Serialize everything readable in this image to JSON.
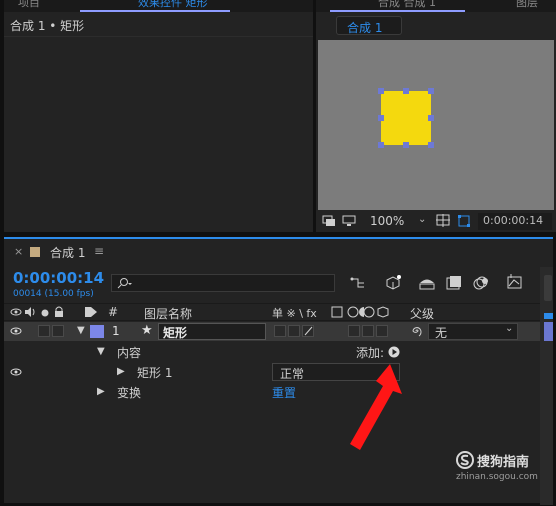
{
  "effect_controls": {
    "top_tab_left": "项目",
    "top_tab_right": "效果控件 矩形",
    "comp_breadcrumb": "合成 1 • 矩形"
  },
  "composition_viewer": {
    "tab_label": "合成 1",
    "top_tab": "合成 合成 1",
    "top_tab_right": "图层",
    "zoom_value": "100%",
    "timecode": "0:00:00:14",
    "shape_color": "#f4d90e"
  },
  "timeline": {
    "tab_title": "合成 1",
    "current_time": "0:00:00:14",
    "frame_info": "00014 (15.00 fps)",
    "search_placeholder": "",
    "col_hash": "#",
    "col_layer_name": "图层名称",
    "col_parent": "父级",
    "switch_icons": "单 ※ \\ fx",
    "layer": {
      "index": "1",
      "name": "矩形",
      "parent_value": "无"
    },
    "contents_label": "内容",
    "add_label": "添加:",
    "rect_label": "矩形 1",
    "blend_mode": "正常",
    "transform_label": "变换",
    "reset_label": "重置"
  },
  "watermark": {
    "brand": "搜狗指南",
    "url": "zhinan.sogou.com"
  },
  "colors": {
    "accent_blue": "#2d8ceb",
    "label_color": "#7c87e8",
    "arrow_red": "#ff1616"
  }
}
